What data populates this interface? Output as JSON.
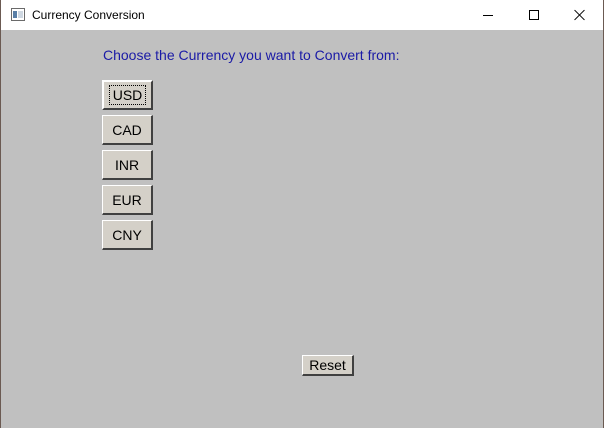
{
  "window": {
    "title": "Currency Conversion",
    "app_icon": "window-app-icon",
    "controls": {
      "minimize_icon": "minimize-icon",
      "maximize_icon": "maximize-icon",
      "close_icon": "close-icon"
    }
  },
  "main": {
    "prompt": "Choose the Currency you want to Convert from:",
    "currencies": [
      {
        "label": "USD",
        "focused": true
      },
      {
        "label": "CAD",
        "focused": false
      },
      {
        "label": "INR",
        "focused": false
      },
      {
        "label": "EUR",
        "focused": false
      },
      {
        "label": "CNY",
        "focused": false
      }
    ],
    "reset_label": "Reset"
  },
  "colors": {
    "background": "#c0c0c0",
    "prompt_text": "#1a1aa6",
    "titlebar": "#ffffff"
  }
}
